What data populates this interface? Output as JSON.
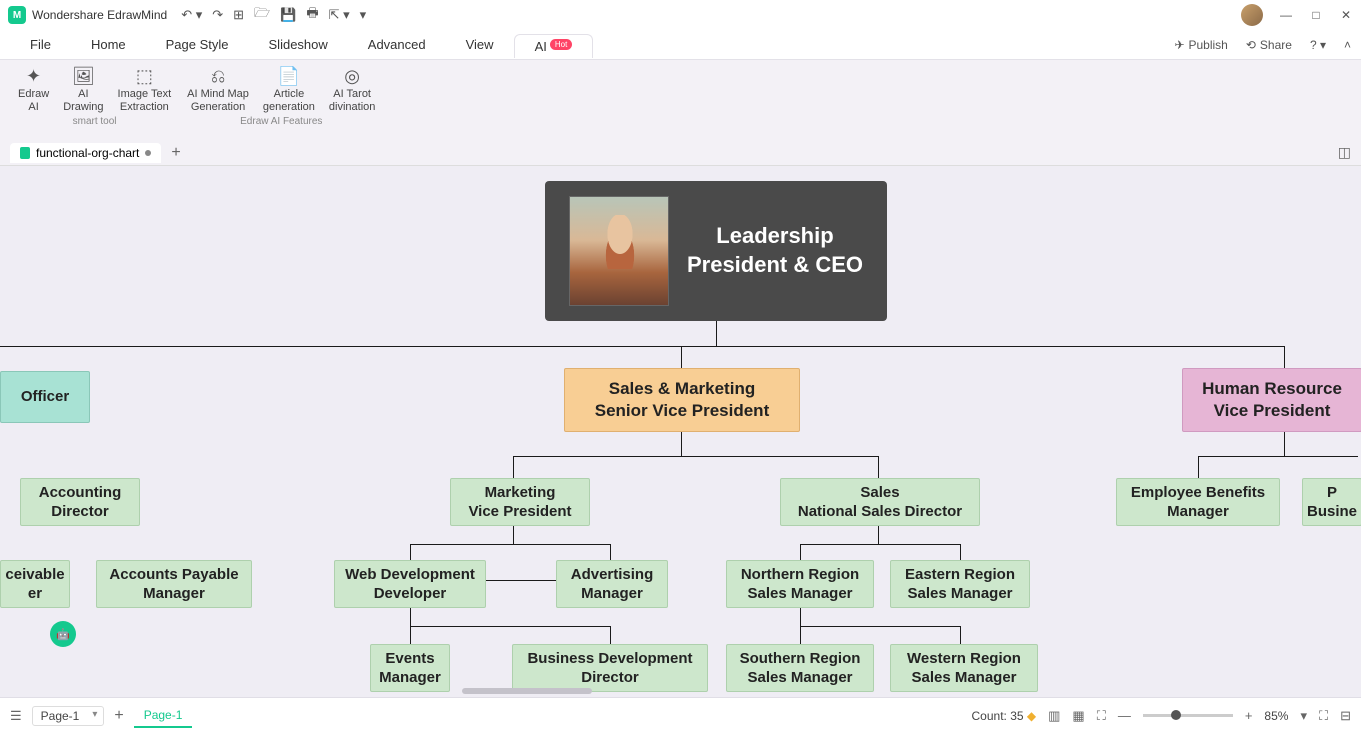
{
  "titlebar": {
    "app_name": "Wondershare EdrawMind"
  },
  "menu": {
    "items": [
      "File",
      "Home",
      "Page Style",
      "Slideshow",
      "Advanced",
      "View",
      "AI"
    ],
    "hot": "Hot",
    "publish": "Publish",
    "share": "Share"
  },
  "ribbon": {
    "group1_label": "smart tool",
    "group2_label": "Edraw AI Features",
    "tools": {
      "edraw_ai": "Edraw\nAI",
      "ai_drawing": "AI\nDrawing",
      "image_text": "Image Text\nExtraction",
      "mindmap": "AI Mind Map\nGeneration",
      "article": "Article\ngeneration",
      "tarot": "AI Tarot\ndivination"
    }
  },
  "doctab": {
    "name": "functional-org-chart"
  },
  "nodes": {
    "root_l1": "Leadership",
    "root_l2": "President & CEO",
    "officer": "Officer",
    "sales_mkt_l1": "Sales & Marketing",
    "sales_mkt_l2": "Senior Vice President",
    "hr_l1": "Human Resource",
    "hr_l2": "Vice President",
    "acct_l1": "Accounting",
    "acct_l2": "Director",
    "mkt_l1": "Marketing",
    "mkt_l2": "Vice President",
    "sales_l1": "Sales",
    "sales_l2": "National Sales Director",
    "benefits_l1": "Employee Benefits",
    "benefits_l2": "Manager",
    "p_l1": "P",
    "p_l2": "Busine",
    "recv_l1": "ceivable",
    "recv_l2": "er",
    "payable_l1": "Accounts Payable",
    "payable_l2": "Manager",
    "webdev_l1": "Web Development",
    "webdev_l2": "Developer",
    "adv_l1": "Advertising",
    "adv_l2": "Manager",
    "north_l1": "Northern Region",
    "north_l2": "Sales Manager",
    "east_l1": "Eastern Region",
    "east_l2": "Sales Manager",
    "events_l1": "Events",
    "events_l2": "Manager",
    "bizdev_l1": "Business Development",
    "bizdev_l2": "Director",
    "south_l1": "Southern Region",
    "south_l2": "Sales Manager",
    "west_l1": "Western Region",
    "west_l2": "Sales Manager"
  },
  "status": {
    "page_select": "Page-1",
    "page_label": "Page-1",
    "count": "Count: 35",
    "zoom": "85%"
  }
}
